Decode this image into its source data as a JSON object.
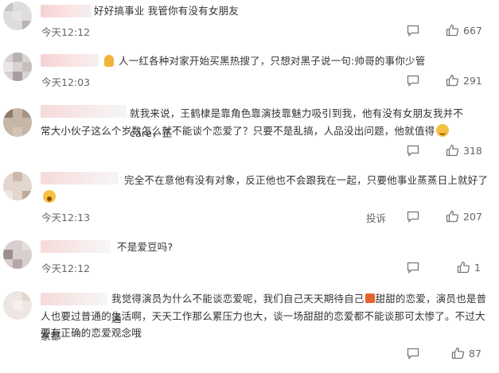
{
  "comments": [
    {
      "text": "好好搞事业 我管你有没有女朋友",
      "time": "今天12:12",
      "likes": "667",
      "report": ""
    },
    {
      "text": "人一红各种对家开始买黑热搜了，只想对黑子说一句:帅哥的事你少管",
      "time": "今天12:03",
      "likes": "291",
      "report": ""
    },
    {
      "text_lines": [
        "就我来说，王鹤棣是靠角色靠演技靠魅力吸引到我，他有没有女朋友我并不care，正",
        "常大小伙子这么个岁数怎么就不能谈个恋爱了？只要不是乱搞，人品没出问题，他就值得"
      ],
      "time": "",
      "likes": "318",
      "report": ""
    },
    {
      "text": "完全不在意他有没有对象，反正他也不会跟我在一起，只要他事业蒸蒸日上就好了",
      "time": "今天12:13",
      "likes": "207",
      "report": "投诉"
    },
    {
      "text": "不是爱豆吗?",
      "time": "今天12:12",
      "likes": "1",
      "report": ""
    },
    {
      "text_lines": [
        "我觉得演员为什么不能谈恋爱呢，我们自己天天期待自己",
        "甜甜的恋爱，演员也是普通",
        "人也要过普通的生活啊，天天工作那么累压力也大，谈一场甜甜的恋爱都不能谈那可太惨了。不过大家都",
        "要有正确的恋爱观念哦"
      ],
      "time": "",
      "likes": "87",
      "report": ""
    }
  ],
  "icons": {
    "comment": "comment-icon",
    "like": "thumbs-up-icon"
  }
}
